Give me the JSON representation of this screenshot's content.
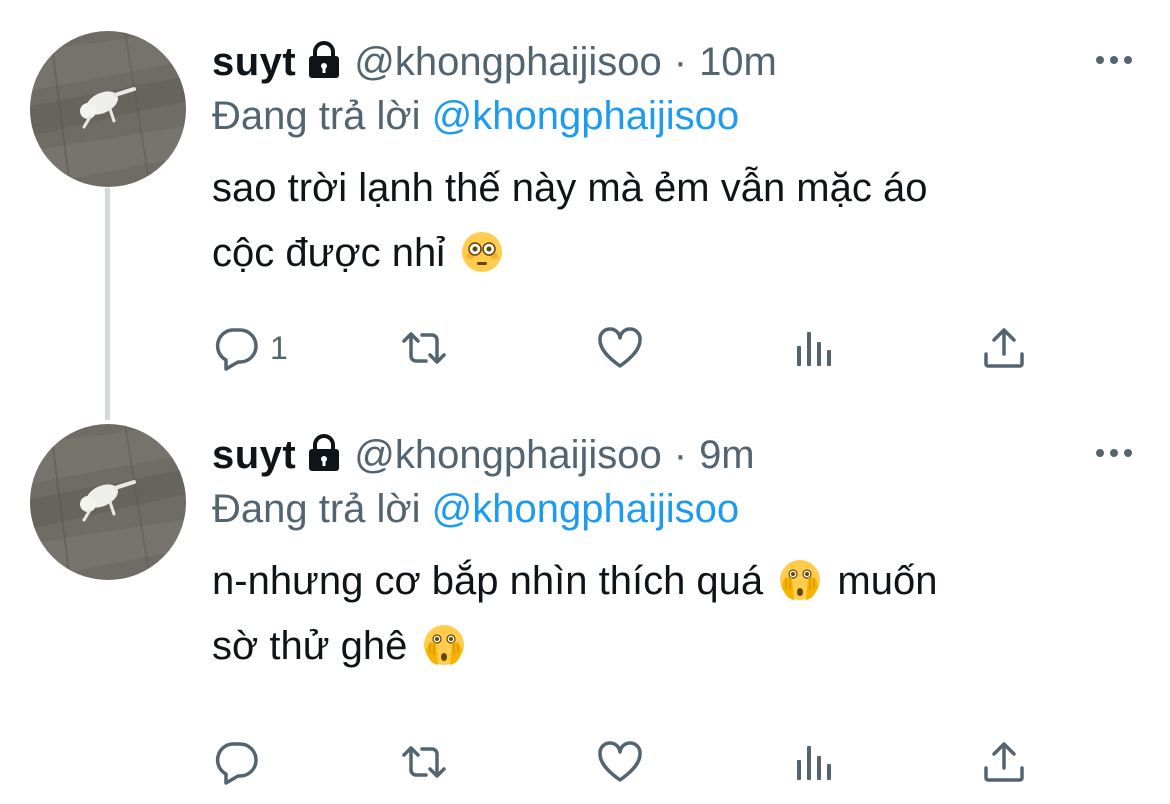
{
  "tweets": [
    {
      "display_name": "suyt",
      "handle": "@khongphaijisoo",
      "separator": "·",
      "timestamp": "10m",
      "reply_prefix": "Đang trả lời",
      "reply_to": "@khongphaijisoo",
      "text_line_1": "sao trời lạnh thế này mà ẻm vẫn mặc áo",
      "text_line_2": "cộc được nhỉ",
      "emojis": [
        "flushed-face-emoji"
      ],
      "reply_count": "1"
    },
    {
      "display_name": "suyt",
      "handle": "@khongphaijisoo",
      "separator": "·",
      "timestamp": "9m",
      "reply_prefix": "Đang trả lời",
      "reply_to": "@khongphaijisoo",
      "text_line_1_a": "n-nhưng cơ bắp nhìn thích quá",
      "text_line_1_b": "muốn",
      "text_line_2": "sờ thử ghê",
      "emojis": [
        "face-with-peeking-eye-emoji",
        "face-with-peeking-eye-emoji"
      ],
      "reply_count": ""
    }
  ],
  "icons": {
    "lock": "lock-icon",
    "more": "more-dots-icon",
    "reply": "reply-bubble-icon",
    "retweet": "retweet-icon",
    "like": "heart-icon",
    "views": "views-bars-icon",
    "share": "share-upload-icon"
  },
  "colors": {
    "text": "#0f1419",
    "secondary": "#536471",
    "link": "#1d9bf0",
    "thread_line": "#cfd9de"
  }
}
